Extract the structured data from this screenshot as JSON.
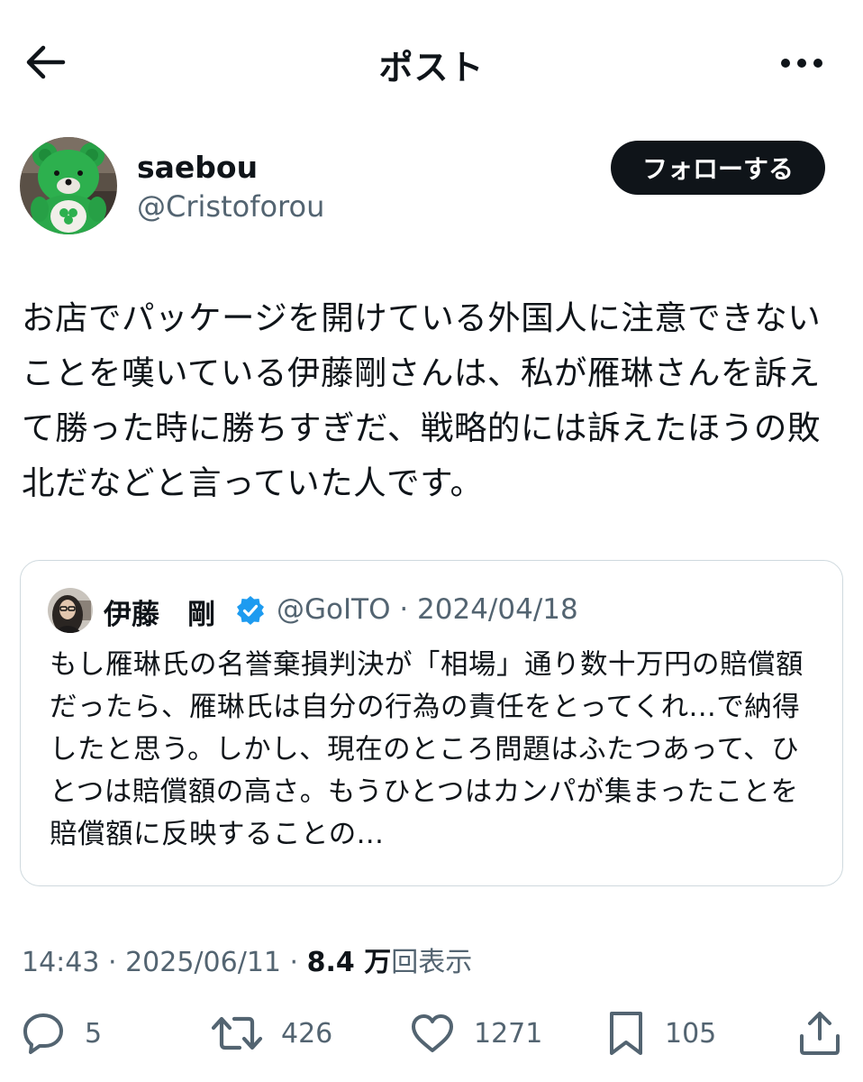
{
  "header": {
    "title": "ポスト",
    "back_icon": "arrow-left-icon",
    "more_icon": "more-horizontal-icon"
  },
  "author": {
    "display_name": "saebou",
    "handle": "@Cristoforou",
    "follow_label": "フォローする"
  },
  "post": {
    "text": "お店でパッケージを開けている外国人に注意できないことを嘆いている伊藤剛さんは、私が雁琳さんを訴えて勝った時に勝ちすぎだ、戦略的には訴えたほうの敗北だなどと言っていた人です。"
  },
  "quote": {
    "display_name": "伊藤　剛",
    "handle": "@GoITO",
    "date": "2024/04/18",
    "text": "もし雁琳氏の名誉棄損判決が「相場」通り数十万円の賠償額だったら、雁琳氏は自分の行為の責任をとってくれ...で納得したと思う。しかし、現在のところ問題はふたつあって、ひとつは賠償額の高さ。もうひとつはカンパが集まったことを賠償額に反映することの..."
  },
  "meta": {
    "time": "14:43",
    "date": "2025/06/11",
    "views_count": "8.4 万",
    "views_label": "回表示"
  },
  "actions": {
    "replies": "5",
    "reposts": "426",
    "likes": "1271",
    "bookmarks": "105"
  },
  "colors": {
    "text": "#0f1419",
    "secondary": "#536471",
    "border": "#cfd9de",
    "verified": "#1d9bf0"
  }
}
